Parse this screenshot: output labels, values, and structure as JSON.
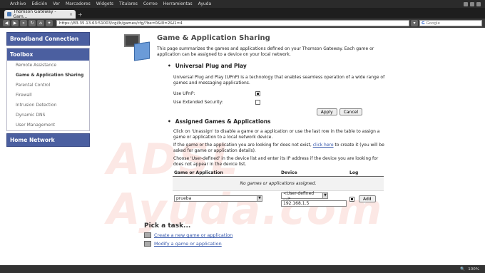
{
  "browser": {
    "menu": [
      "Archivo",
      "Edición",
      "Ver",
      "Marcadores",
      "Widgets",
      "Titulares",
      "Correo",
      "Herramientas",
      "Ayuda"
    ],
    "tab_title": "Thomson Gateway - Gam...",
    "url": "https://83.35.13.63:51003/cgi/b/games/cfg/?be=0&l0=2&l1=4",
    "search_placeholder": "Google",
    "zoom": "100%"
  },
  "sidebar": {
    "broadband": "Broadband Connection",
    "toolbox": "Toolbox",
    "items": [
      "Remote Assistance",
      "Game & Application Sharing",
      "Parental Control",
      "Firewall",
      "Intrusion Detection",
      "Dynamic DNS",
      "User Management"
    ],
    "home_network": "Home Network"
  },
  "main": {
    "title": "Game & Application Sharing",
    "intro": "This page summarizes the games and applications defined on your Thomson Gateway. Each game or application can be assigned to a device on your local network.",
    "upnp": {
      "title": "Universal Plug and Play",
      "text": "Universal Plug and Play (UPnP) is a technology that enables seamless operation of a wide range of games and messaging applications.",
      "use_upnp": "Use UPnP:",
      "use_ext": "Use Extended Security:",
      "apply": "Apply",
      "cancel": "Cancel"
    },
    "assigned": {
      "title": "Assigned Games & Applications",
      "text1": "Click on 'Unassign' to disable a game or a application or use the last row in the table to assign a game or application to a local network device.",
      "text2a": "If the game or the application you are looking for does not exist,",
      "click_here": "click here",
      "text2b": "to create it (you will be asked for game or application details).",
      "text3": "Choose 'User-defined' in the device list and enter its IP address if the device you are looking for does not appear in the device list.",
      "col_game": "Game or Application",
      "col_device": "Device",
      "col_log": "Log",
      "empty": "No games or applications assigned.",
      "game_value": "prueba",
      "device_value": "<User-defined ...>",
      "ip_value": "192.168.1.5",
      "add": "Add"
    },
    "tasks": {
      "title": "Pick a task...",
      "items": [
        "Create a new game or application",
        "Modify a game or application"
      ]
    }
  }
}
